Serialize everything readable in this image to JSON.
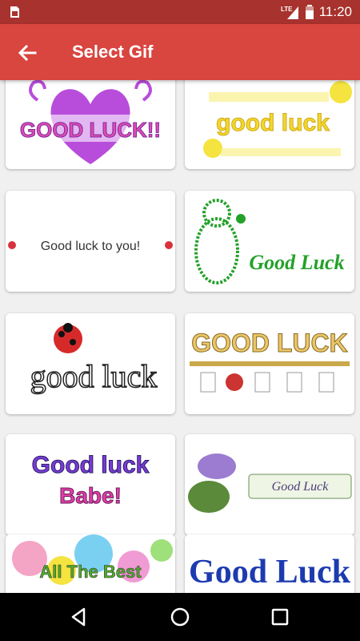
{
  "status_bar": {
    "network": "LTE",
    "time": "11:20",
    "icons": [
      "sim-card-icon",
      "signal-icon",
      "battery-icon"
    ]
  },
  "app_bar": {
    "title": "Select Gif",
    "back_icon": "arrow-left-icon",
    "color": "#d9453f"
  },
  "gifs": [
    {
      "text": "GOOD LUCK!!"
    },
    {
      "text": "good luck"
    },
    {
      "text": "Good luck to you!"
    },
    {
      "text": "Good Luck"
    },
    {
      "text": "good luck"
    },
    {
      "text": "GOOD LUCK"
    },
    {
      "text_line1": "Good luck",
      "text_line2": "Babe!"
    },
    {
      "text": "Good Luck"
    },
    {
      "text": "All The Best"
    },
    {
      "text": "Good Luck"
    }
  ],
  "nav_bar": {
    "buttons": [
      "back-triangle-icon",
      "home-circle-icon",
      "recents-square-icon"
    ]
  }
}
